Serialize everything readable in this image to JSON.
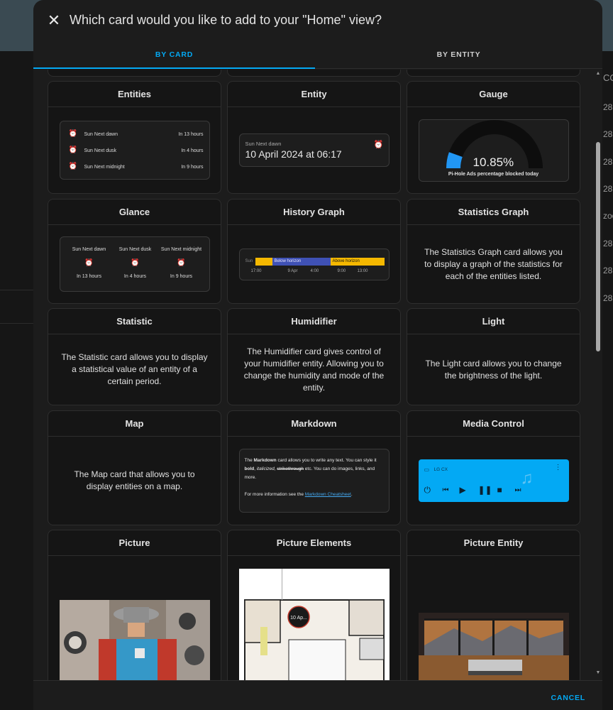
{
  "dialog": {
    "title": "Which card would you like to add to your \"Home\" view?",
    "close_icon": "close-icon",
    "cancel_label": "CANCEL"
  },
  "tabs": [
    {
      "label": "BY CARD",
      "active": true
    },
    {
      "label": "BY ENTITY",
      "active": false
    }
  ],
  "background": {
    "right_values": [
      "CO",
      "28",
      "28",
      "28",
      "28",
      "zoo",
      "28",
      "28",
      "28"
    ]
  },
  "colors": {
    "accent": "#03a9f4",
    "history_yellow": "#f5b800",
    "history_blue": "#3f51b5",
    "gauge_blue": "#2196f3"
  },
  "cards": {
    "entities": {
      "title": "Entities",
      "rows": [
        {
          "name": "Sun Next dawn",
          "value": "In 13 hours",
          "icon": "sun-clock-icon"
        },
        {
          "name": "Sun Next dusk",
          "value": "In 4 hours",
          "icon": "sun-clock-icon"
        },
        {
          "name": "Sun Next midnight",
          "value": "In 9 hours",
          "icon": "sun-clock-icon"
        }
      ]
    },
    "entity": {
      "title": "Entity",
      "name": "Sun Next dawn",
      "value": "10 April 2024 at 06:17",
      "icon": "sun-clock-icon"
    },
    "gauge": {
      "title": "Gauge",
      "value_text": "10.85%",
      "value_fraction": 0.1085,
      "label": "Pi-Hole Ads percentage blocked today"
    },
    "glance": {
      "title": "Glance",
      "items": [
        {
          "name": "Sun Next dawn",
          "value": "In 13 hours"
        },
        {
          "name": "Sun Next dusk",
          "value": "In 4 hours"
        },
        {
          "name": "Sun Next midnight",
          "value": "In 9 hours"
        }
      ]
    },
    "history_graph": {
      "title": "History Graph",
      "row_label": "Sun",
      "segments": [
        {
          "label": "Below horizon",
          "state": "below"
        },
        {
          "label": "Above horizon",
          "state": "above"
        }
      ],
      "ticks": [
        "17:00",
        "9 Apr",
        "4:00",
        "9:00",
        "13:00"
      ]
    },
    "statistics_graph": {
      "title": "Statistics Graph",
      "description": "The Statistics Graph card allows you to display a graph of the statistics for each of the entities listed."
    },
    "statistic": {
      "title": "Statistic",
      "description": "The Statistic card allows you to display a statistical value of an entity of a certain period."
    },
    "humidifier": {
      "title": "Humidifier",
      "description": "The Humidifier card gives control of your humidifier entity. Allowing you to change the humidity and mode of the entity."
    },
    "light": {
      "title": "Light",
      "description": "The Light card allows you to change the brightness of the light."
    },
    "map": {
      "title": "Map",
      "description": "The Map card that allows you to display entities on a map."
    },
    "markdown": {
      "title": "Markdown",
      "p1_a": "The ",
      "p1_b": "Markdown",
      "p1_c": " card allows you to write any text. You can style it ",
      "p1_d": "bold",
      "p1_e": ", ",
      "p1_f": "italicized",
      "p1_g": ", ",
      "p1_h": "strikethrough",
      "p1_i": " etc. You can do images, links, and more.",
      "p2_a": "For more information see the ",
      "p2_link": "Markdown Cheatsheet",
      "p2_b": "."
    },
    "media_control": {
      "title": "Media Control",
      "player_name": "LG CX",
      "icons": [
        "power-icon",
        "skip-previous-icon",
        "play-icon",
        "pause-icon",
        "stop-icon",
        "skip-next-icon"
      ]
    },
    "picture": {
      "title": "Picture"
    },
    "picture_elements": {
      "title": "Picture Elements",
      "badge": "10 Ap..."
    },
    "picture_entity": {
      "title": "Picture Entity"
    }
  }
}
